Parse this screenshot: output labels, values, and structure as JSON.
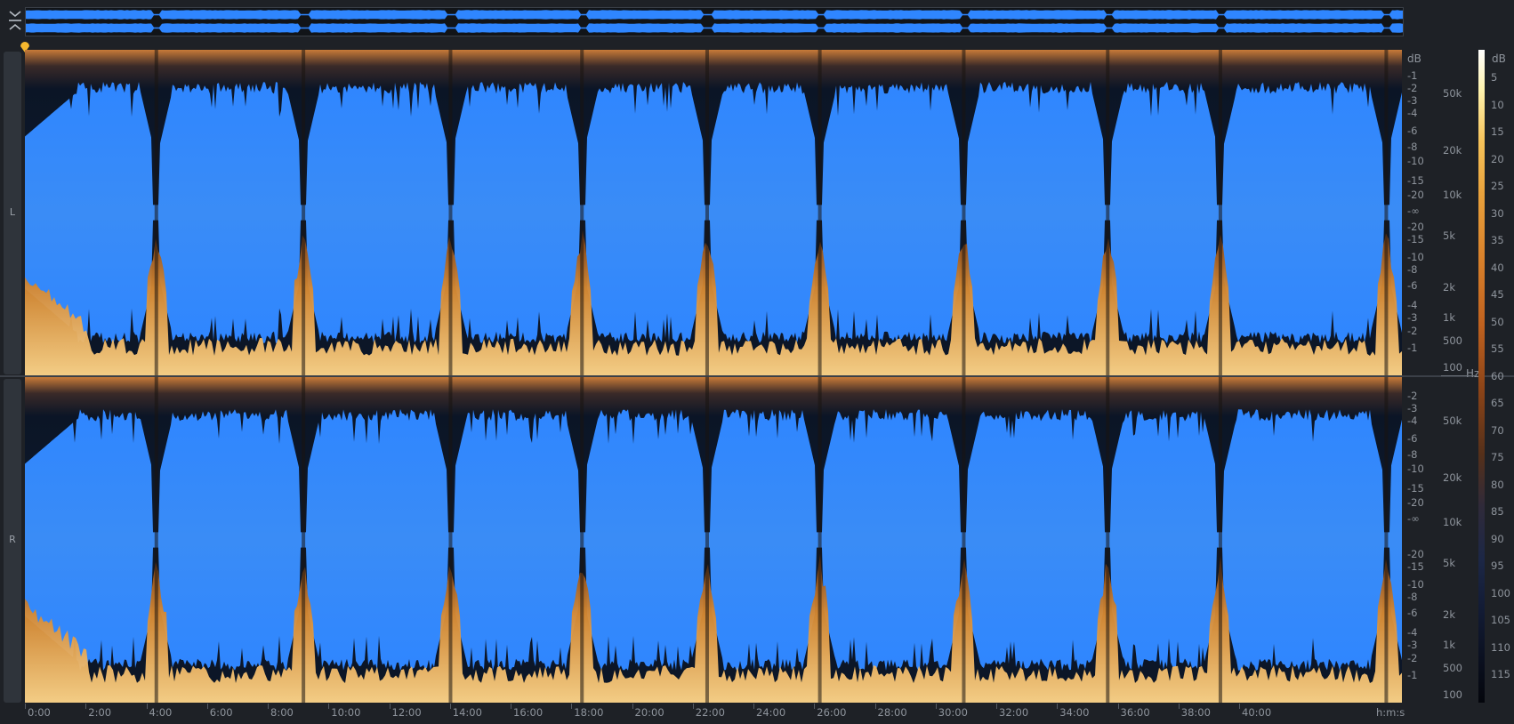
{
  "overview": {
    "collapse_icon": "collapse-chevrons-icon"
  },
  "channels": [
    {
      "label": "L"
    },
    {
      "label": "R"
    }
  ],
  "amplitude_axis": {
    "unit": "dB",
    "upper_ticks": [
      "-1",
      "-2",
      "-3",
      "-4",
      "-6",
      "-8",
      "-10",
      "-15",
      "-20",
      "-∞"
    ],
    "lower_ticks": [
      "-20",
      "-15",
      "-10",
      "-8",
      "-6",
      "-4",
      "-3",
      "-2",
      "-1"
    ]
  },
  "frequency_axis": {
    "unit": "Hz",
    "ticks": [
      "50k",
      "20k",
      "10k",
      "5k",
      "2k",
      "1k",
      "500",
      "100"
    ]
  },
  "time_axis": {
    "unit": "h:m:s",
    "ticks": [
      "0:00",
      "2:00",
      "4:00",
      "6:00",
      "8:00",
      "10:00",
      "12:00",
      "14:00",
      "16:00",
      "18:00",
      "20:00",
      "22:00",
      "24:00",
      "26:00",
      "28:00",
      "30:00",
      "32:00",
      "34:00",
      "36:00",
      "38:00",
      "40:00"
    ]
  },
  "colorbar": {
    "unit": "dB",
    "ticks": [
      "5",
      "10",
      "15",
      "20",
      "25",
      "30",
      "35",
      "40",
      "45",
      "50",
      "55",
      "60",
      "65",
      "70",
      "75",
      "80",
      "85",
      "90",
      "95",
      "100",
      "105",
      "110",
      "115"
    ]
  },
  "colors": {
    "waveform": "#2f86ff",
    "background": "#1e2126",
    "spectrogram_hot": "#f0a53a",
    "playhead": "#f5b82e"
  },
  "gaps_minutes": [
    4.2,
    8.9,
    13.6,
    17.8,
    21.8,
    25.4,
    30.0,
    34.6,
    38.2,
    43.5
  ]
}
